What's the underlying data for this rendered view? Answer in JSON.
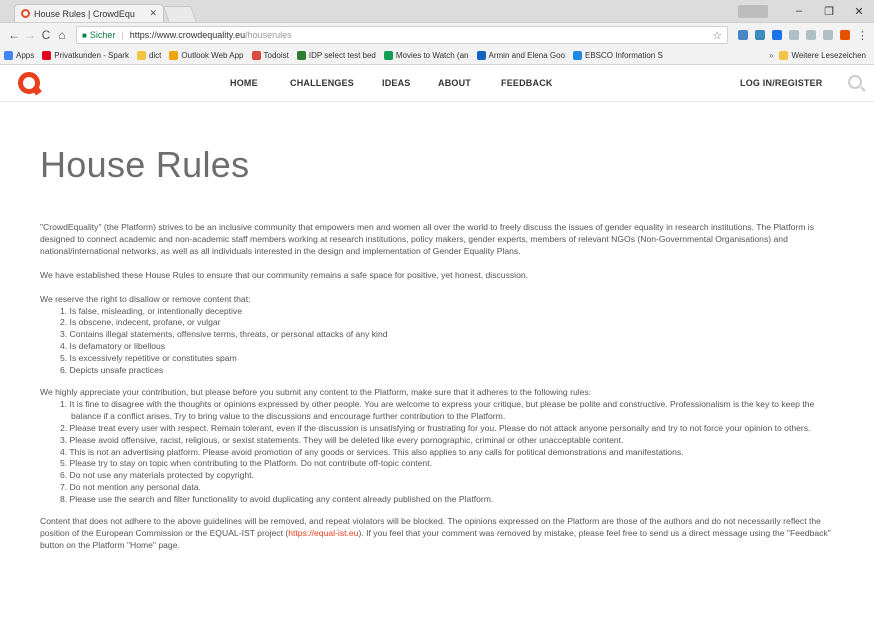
{
  "browser": {
    "tab_title": "House Rules | CrowdEqu",
    "secure_label": "Sicher",
    "url_prefix": "https://www.crowdequality.eu",
    "url_path": "/houserules",
    "user_button": "",
    "bookmarks": [
      {
        "label": "Apps",
        "color": "#4285f4"
      },
      {
        "label": "Privatkunden - Spark",
        "color": "#e2001a"
      },
      {
        "label": "dict",
        "color": "#f4c542"
      },
      {
        "label": "Outlook Web App",
        "color": "#f0a30a"
      },
      {
        "label": "Todoist",
        "color": "#db4c3f"
      },
      {
        "label": "IDP select test bed",
        "color": "#2e7d32"
      },
      {
        "label": "Movies to Watch (an",
        "color": "#0f9d58"
      },
      {
        "label": "Armin and Elena Goo",
        "color": "#1565c0"
      },
      {
        "label": "EBSCO Information S",
        "color": "#1e88e5"
      }
    ],
    "bookmarks_more": "»",
    "other_bookmarks": "Weitere Lesezeichen"
  },
  "site": {
    "nav": [
      "HOME",
      "CHALLENGES",
      "IDEAS",
      "ABOUT",
      "FEEDBACK"
    ],
    "login": "LOG IN/REGISTER",
    "brand_color": "#e8401c"
  },
  "page": {
    "title": "House Rules",
    "intro": "\"CrowdEquality\" (the Platform) strives to be an inclusive community that empowers men and women all over the world to freely discuss the issues of gender equality in research institutions. The Platform is designed to connect academic and non-academic staff members working at research institutions, policy makers, gender experts, members of relevant NGOs (Non-Governmental Organisations) and national/international networks, as well as all individuals interested in the design and implementation of Gender Equality Plans.",
    "purpose": "We have established these House Rules to ensure that our community remains a safe space for positive, yet honest, discussion.",
    "reserve_intro": "We reserve the right to disallow or remove content that:",
    "reserve_items": [
      "1. Is false, misleading, or intentionally deceptive",
      "2. Is obscene, indecent, profane, or vulgar",
      "3. Contains illegal statements, offensive terms, threats, or personal attacks of any kind",
      "4. Is defamatory or libellous",
      "5. Is excessively repetitive or constitutes spam",
      "6. Depicts unsafe practices"
    ],
    "rules_intro": "We highly appreciate your contribution, but please before you submit any content to the Platform, make sure that it adheres to the following rules:",
    "rules_items": [
      "1. It is fine to disagree with the thoughts or opinions expressed by other people. You are welcome to express your critique, but please be polite and constructive. Professionalism is the key to keep the balance if a conflict arises. Try to bring value to the discussions and encourage further contribution to the Platform.",
      "2. Please treat every user with respect. Remain tolerant, even if the discussion is unsatisfying or frustrating for you. Please do not attack anyone personally and try to not force your opinion to others.",
      "3. Please avoid offensive, racist, religious, or sexist statements. They will be deleted like every pornographic, criminal or other unacceptable content.",
      "4. This is not an advertising platform. Please avoid promotion of any goods or services. This also applies to any calls for political demonstrations and manifestations.",
      "5. Please try to stay on topic when contributing to the Platform. Do not contribute off-topic content.",
      "6. Do not use any materials protected by copyright.",
      "7. Do not mention any personal data.",
      "8. Please use the search and filter functionality to avoid duplicating any content already published on the Platform."
    ],
    "closing_a": "Content that does not adhere to the above guidelines will be removed, and repeat violators will be blocked. The opinions expressed on the Platform are those of the authors and do not necessarily reflect the position of the European Commission or the EQUAL-IST project (",
    "closing_link": "https://equal-ist.eu",
    "closing_b": "). If you feel that your comment was removed by mistake, please feel free to send us a direct message using the \"Feedback\" button on the Platform \"Home\" page."
  }
}
